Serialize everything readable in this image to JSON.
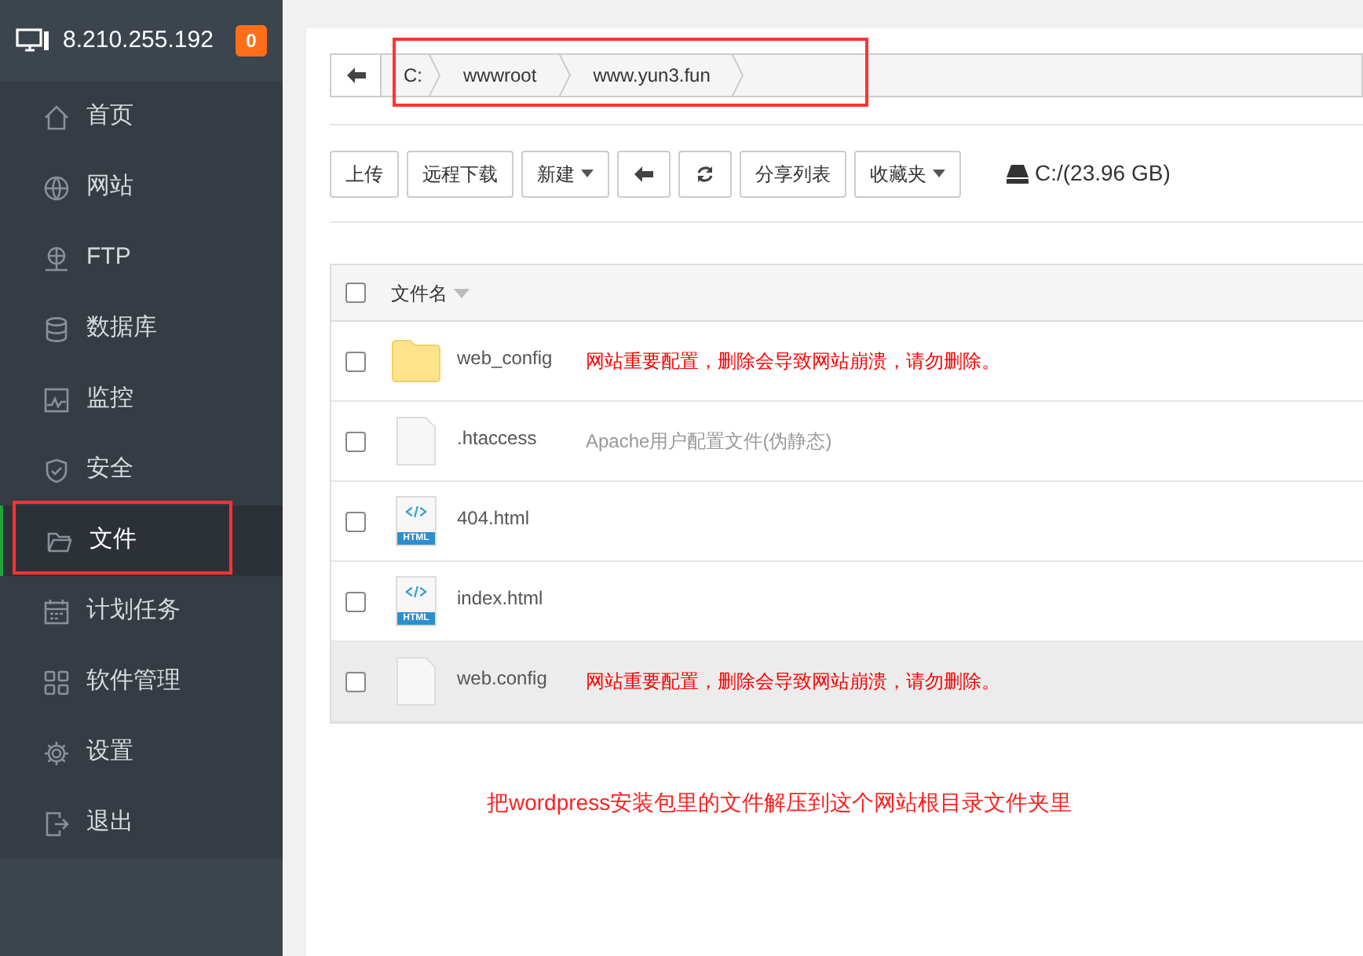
{
  "server": {
    "address": "8.210.255.192",
    "badge": "0"
  },
  "sidebar": {
    "items": [
      {
        "label": "首页",
        "kind": "home",
        "selected": false
      },
      {
        "label": "网站",
        "kind": "globe",
        "selected": false
      },
      {
        "label": "FTP",
        "kind": "ftp",
        "selected": false
      },
      {
        "label": "数据库",
        "kind": "database",
        "selected": false
      },
      {
        "label": "监控",
        "kind": "monitor",
        "selected": false
      },
      {
        "label": "安全",
        "kind": "shield",
        "selected": false
      },
      {
        "label": "文件",
        "kind": "folder",
        "selected": true
      },
      {
        "label": "计划任务",
        "kind": "calendar",
        "selected": false
      },
      {
        "label": "软件管理",
        "kind": "grid",
        "selected": false
      },
      {
        "label": "设置",
        "kind": "gear",
        "selected": false
      },
      {
        "label": "退出",
        "kind": "logout",
        "selected": false
      }
    ]
  },
  "breadcrumb": [
    "C:",
    "wwwroot",
    "www.yun3.fun"
  ],
  "toolbar": [
    {
      "kind": "text",
      "label": "上传"
    },
    {
      "kind": "text",
      "label": "远程下载"
    },
    {
      "kind": "dropdown",
      "label": "新建"
    },
    {
      "kind": "back"
    },
    {
      "kind": "refresh"
    },
    {
      "kind": "text",
      "label": "分享列表"
    },
    {
      "kind": "dropdown",
      "label": "收藏夹"
    }
  ],
  "disk": "C:/(23.96 GB)",
  "table": {
    "column": "文件名",
    "all_checked": false,
    "rows": [
      {
        "kind": "folder",
        "name": "web_config",
        "note": {
          "text": "网站重要配置，删除会导致网站崩溃，请勿删除。",
          "color": "#ff0000"
        },
        "checked": false,
        "highlighted": false
      },
      {
        "kind": "file",
        "name": ".htaccess",
        "note": {
          "text": "Apache用户配置文件(伪静态)",
          "color": "#999999"
        },
        "checked": false,
        "highlighted": false
      },
      {
        "kind": "html",
        "name": "404.html",
        "badge": "HTML",
        "checked": false,
        "highlighted": false
      },
      {
        "kind": "html",
        "name": "index.html",
        "badge": "HTML",
        "checked": false,
        "highlighted": false
      },
      {
        "kind": "file",
        "name": "web.config",
        "note": {
          "text": "网站重要配置，删除会导致网站崩溃，请勿删除。",
          "color": "#ff0000"
        },
        "checked": false,
        "highlighted": true
      }
    ]
  },
  "annotation": "把wordpress安装包里的文件解压到这个网站根目录文件夹里"
}
